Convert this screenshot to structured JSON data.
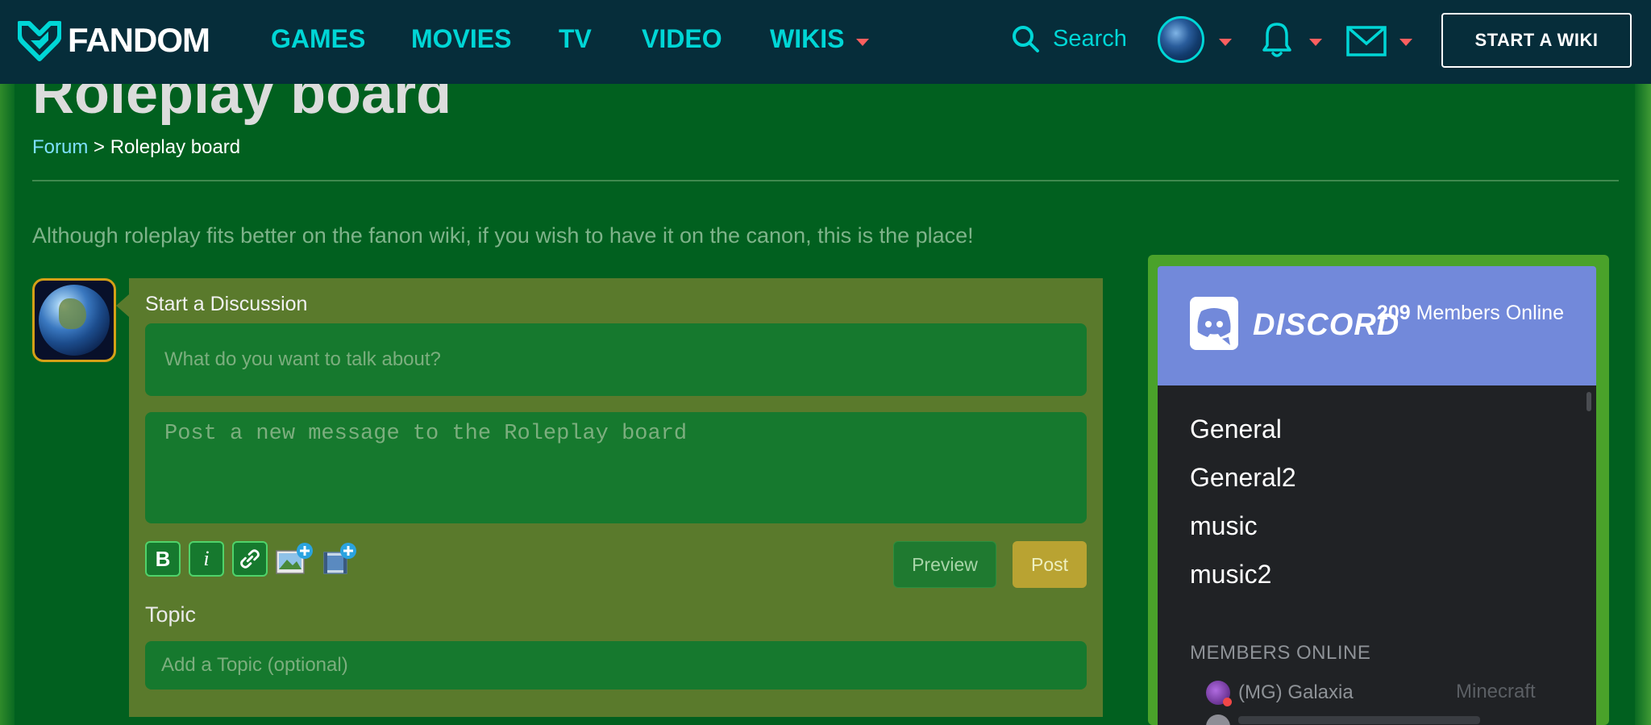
{
  "nav": {
    "brand": "FANDOM",
    "links": [
      "GAMES",
      "MOVIES",
      "TV",
      "VIDEO",
      "WIKIS"
    ],
    "search_label": "Search",
    "start_wiki": "START A WIKI",
    "icons": [
      "search-icon",
      "avatar",
      "bell-icon",
      "mail-icon"
    ],
    "accent": "#00d6d6",
    "caret_color": "#fd5f5f"
  },
  "page": {
    "title": "Roleplay board",
    "breadcrumb": {
      "parent": "Forum",
      "separator": ">",
      "current": "Roleplay board"
    },
    "description": "Although roleplay fits better on the fanon wiki, if you wish to have it on the canon, this is the place!"
  },
  "discussion": {
    "heading": "Start a Discussion",
    "title_placeholder": "What do you want to talk about?",
    "message_placeholder": "Post a new message to the Roleplay board",
    "toolbar": [
      "bold-icon",
      "italic-icon",
      "link-icon",
      "add-image-icon",
      "add-video-icon"
    ],
    "bold_glyph": "B",
    "italic_glyph": "i",
    "preview": "Preview",
    "post": "Post",
    "topic_label": "Topic",
    "topic_placeholder": "Add a Topic (optional)"
  },
  "discord": {
    "brand": "DISCORD",
    "members_count": "209",
    "members_label": "Members Online",
    "channels": [
      "General",
      "General2",
      "music",
      "music2"
    ],
    "members_title": "MEMBERS ONLINE",
    "members": [
      {
        "name": "(MG) Galaxia",
        "game": "Minecraft"
      }
    ],
    "header_color": "#7289da"
  }
}
